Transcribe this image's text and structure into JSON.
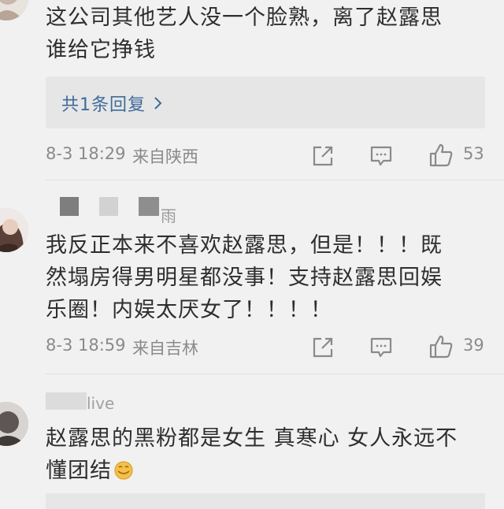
{
  "comments": [
    {
      "text_lines": [
        "这公司其他艺人没一个脸熟，离了赵露思",
        "谁给它挣钱"
      ],
      "replies_label": "共1条回复",
      "time": "8-3 18:29",
      "source": "来自陕西",
      "likes": "53"
    },
    {
      "username": "雨",
      "text_lines": [
        "我反正本来不喜欢赵露思，但是！！！既",
        "然塌房得男明星都没事！支持赵露思回娱",
        "乐圈！内娱太厌女了！！！！"
      ],
      "time": "8-3 18:59",
      "source": "来自吉林",
      "likes": "39"
    },
    {
      "username": "live",
      "text_lines": [
        "赵露思的黑粉都是女生 真寒心 女人永远不",
        "懂团结"
      ]
    }
  ],
  "icons": {
    "share": "share-icon",
    "comment": "comment-icon",
    "like": "thumbs-up-icon",
    "chevron": "chevron-right-icon",
    "emoji": "face-emoji-icon"
  },
  "colors": {
    "background": "#f1f1f1",
    "reply_box": "#e6e6e6",
    "link": "#3f6b99",
    "text": "#2e2e2e",
    "meta": "#8a8a8a"
  }
}
